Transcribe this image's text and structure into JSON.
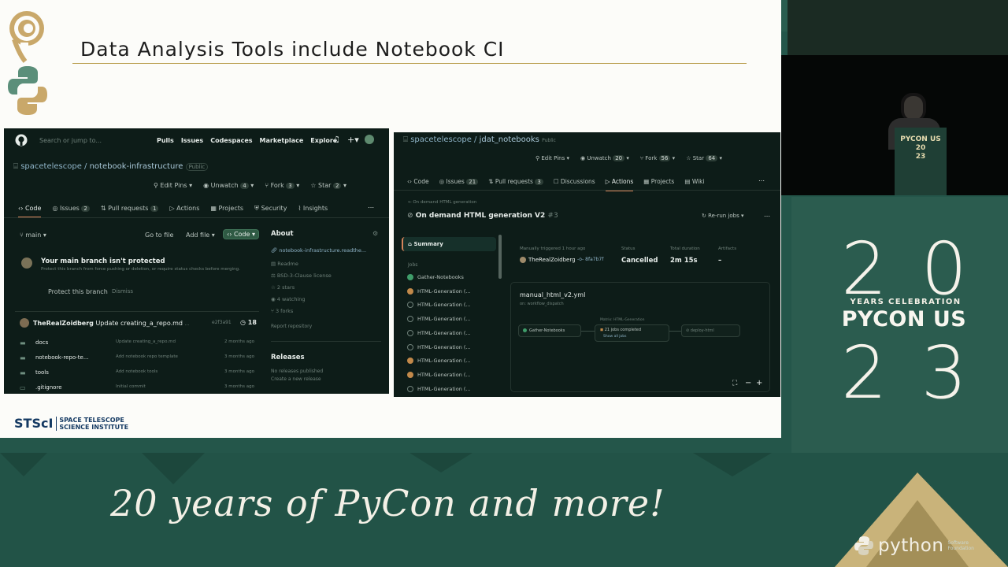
{
  "slide": {
    "title": "Data Analysis Tools include Notebook CI",
    "footer_logo_mark": "STScI",
    "footer_logo_name_line1": "SPACE TELESCOPE",
    "footer_logo_name_line2": "SCIENCE INSTITUTE"
  },
  "panel_left": {
    "search_placeholder": "Search or jump to...",
    "nav": [
      "Pulls",
      "Issues",
      "Codespaces",
      "Marketplace",
      "Explore"
    ],
    "repo_owner": "spacetelescope",
    "repo_name": "notebook-infrastructure",
    "repo_visibility": "Public",
    "actions": {
      "edit_pins": "Edit Pins",
      "unwatch": "Unwatch",
      "unwatch_count": "4",
      "fork": "Fork",
      "fork_count": "3",
      "star": "Star",
      "star_count": "2"
    },
    "tabs": [
      {
        "label": "Code",
        "count": ""
      },
      {
        "label": "Issues",
        "count": "2"
      },
      {
        "label": "Pull requests",
        "count": "1"
      },
      {
        "label": "Actions",
        "count": ""
      },
      {
        "label": "Projects",
        "count": ""
      },
      {
        "label": "Security",
        "count": ""
      },
      {
        "label": "Insights",
        "count": ""
      }
    ],
    "branch": "main",
    "go_to_file": "Go to file",
    "add_file": "Add file",
    "code_button": "Code",
    "protect_title": "Your main branch isn't protected",
    "protect_body": "Protect this branch from force pushing or deletion, or require status checks before merging.",
    "protect_button": "Protect this branch",
    "dismiss": "Dismiss",
    "commit_author": "TheRealZoidberg",
    "commit_message": "Update creating_a_repo.md",
    "commit_tag": "...",
    "commit_hash": "e2f3a91",
    "commit_count": "18",
    "files": [
      {
        "name": "docs",
        "message": "Update creating_a_repo.md",
        "date": "2 months ago"
      },
      {
        "name": "notebook-repo-te...",
        "message": "Add notebook repo template",
        "date": "3 months ago"
      },
      {
        "name": "tools",
        "message": "Add notebook tools",
        "date": "3 months ago"
      },
      {
        "name": ".gitignore",
        "message": "Initial commit",
        "date": "3 months ago"
      }
    ],
    "about_title": "About",
    "about_link": "notebook-infrastructure.readthe...",
    "about_items": [
      "Readme",
      "BSD-3-Clause license",
      "2 stars",
      "4 watching",
      "3 forks"
    ],
    "report": "Report repository",
    "releases_title": "Releases",
    "releases_body": "No releases published",
    "releases_link": "Create a new release"
  },
  "panel_right": {
    "repo_owner": "spacetelescope",
    "repo_name": "jdat_notebooks",
    "repo_visibility": "Public",
    "actions": {
      "edit_pins": "Edit Pins",
      "unwatch": "Unwatch",
      "unwatch_count": "20",
      "fork": "Fork",
      "fork_count": "56",
      "star": "Star",
      "star_count": "64"
    },
    "tabs": [
      {
        "label": "Code",
        "count": ""
      },
      {
        "label": "Issues",
        "count": "21"
      },
      {
        "label": "Pull requests",
        "count": "3"
      },
      {
        "label": "Discussions",
        "count": ""
      },
      {
        "label": "Actions",
        "count": ""
      },
      {
        "label": "Projects",
        "count": ""
      },
      {
        "label": "Wiki",
        "count": ""
      }
    ],
    "back_link": "← On demand HTML generation",
    "run_title": "On demand HTML generation V2",
    "run_number": "#3",
    "rerun": "Re-run jobs",
    "summary": "Summary",
    "jobs_heading": "Jobs",
    "jobs": [
      {
        "label": "Gather-Notebooks",
        "status": "success"
      },
      {
        "label": "HTML-Generation (...",
        "status": "cancelled"
      },
      {
        "label": "HTML-Generation (...",
        "status": "skipped"
      },
      {
        "label": "HTML-Generation (...",
        "status": "skipped"
      },
      {
        "label": "HTML-Generation (...",
        "status": "skipped"
      },
      {
        "label": "HTML-Generation (...",
        "status": "skipped"
      },
      {
        "label": "HTML-Generation (...",
        "status": "cancelled"
      },
      {
        "label": "HTML-Generation (...",
        "status": "cancelled"
      },
      {
        "label": "HTML-Generation (...",
        "status": "skipped"
      }
    ],
    "trigger_label": "Manually triggered 1 hour ago",
    "trigger_user": "TheRealZoidberg",
    "trigger_hash": "8fa7b7f",
    "status_label": "Status",
    "status_value": "Cancelled",
    "duration_label": "Total duration",
    "duration_value": "2m 15s",
    "artifacts_label": "Artifacts",
    "artifacts_value": "–",
    "workflow_file": "manual_html_v2.yml",
    "workflow_trigger": "on: workflow_dispatch",
    "graph_matrix_label": "Matrix: HTML-Generation",
    "graph_job1": "Gather-Notebooks",
    "graph_job2": "21 jobs completed",
    "graph_job2_sub": "Show all jobs",
    "graph_job3": "deploy-html"
  },
  "conference": {
    "podium_line1": "PYCON US",
    "podium_line2": "20",
    "podium_line3": "23",
    "year_top": [
      "2",
      "0"
    ],
    "year_bottom": [
      "2",
      "3"
    ],
    "celebration": "YEARS CELEBRATION",
    "pycon": "PYCON US",
    "tagline": "20 years of PyCon and more!",
    "python_logo_text": "python",
    "python_logo_sub1": "Software",
    "python_logo_sub2": "Foundation"
  },
  "colors": {
    "slide_bg": "#fcfcf9",
    "panel_bg": "#0d1c18",
    "conference_green": "#24564a",
    "title_rule": "#b89c4a",
    "success": "#3f9d6a",
    "cancelled": "#c2894a",
    "skipped": "#6f817a"
  }
}
